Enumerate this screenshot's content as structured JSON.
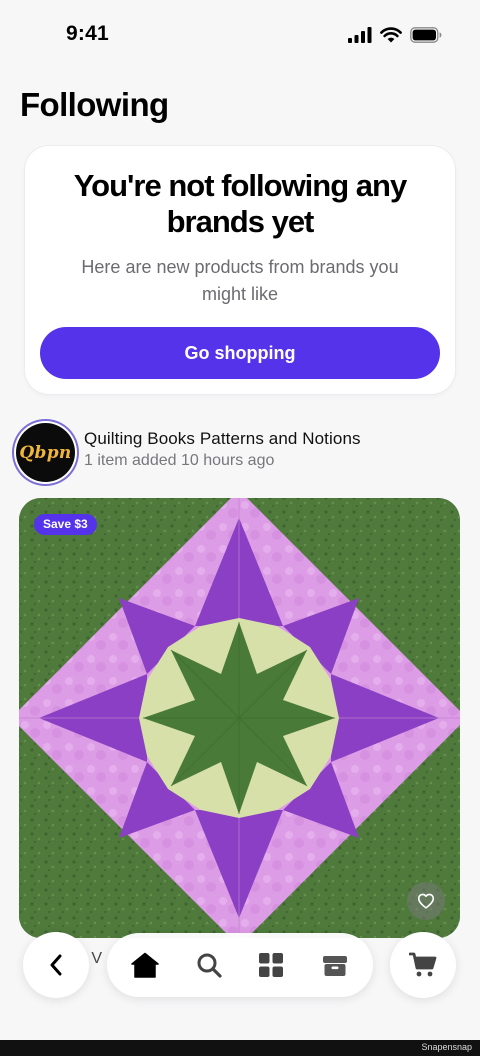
{
  "status_bar": {
    "time": "9:41",
    "icons": [
      "cellular-signal-icon",
      "wifi-icon",
      "battery-icon"
    ]
  },
  "page": {
    "title": "Following"
  },
  "empty_state": {
    "title": "You're not following any brands yet",
    "subtitle": "Here are new products from brands you might like",
    "button_label": "Go shopping"
  },
  "feed": [
    {
      "shop_name": "Quilting Books Patterns and Notions",
      "shop_logo_text": "Qbpn",
      "meta": "1 item added 10 hours ago",
      "product": {
        "badge": "Save $3",
        "title_visible_fragment": "d V",
        "favorite_icon": "heart-icon"
      }
    }
  ],
  "bottom_nav": {
    "back_icon": "chevron-left-icon",
    "items": [
      {
        "name": "home",
        "icon": "home-icon",
        "active": true
      },
      {
        "name": "search",
        "icon": "search-icon",
        "active": false
      },
      {
        "name": "categories",
        "icon": "grid-icon",
        "active": false
      },
      {
        "name": "orders",
        "icon": "box-icon",
        "active": false
      }
    ],
    "cart_icon": "cart-icon"
  },
  "watermark": "Snapensnap",
  "colors": {
    "accent": "#5433eb",
    "background": "#f7f7f8",
    "card": "#ffffff",
    "text_primary": "#000000",
    "text_secondary": "#6b6b70"
  }
}
